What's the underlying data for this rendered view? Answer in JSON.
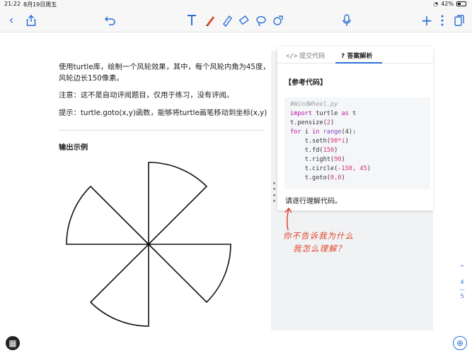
{
  "status": {
    "time": "21:22",
    "date": "8月19日周五",
    "battery": "42%"
  },
  "problem": {
    "line1": "使用turtle库，绘制一个风轮效果，其中，每个风轮内角为45度，",
    "line2": "风轮边长150像素。",
    "note": "注意：这不是自动评阅题目，仅用于练习，没有评阅。",
    "hint": "提示：turtle.goto(x,y)函数，能够将turtle画笔移动到坐标(x,y)",
    "output_title": "输出示例"
  },
  "panel": {
    "tab_submit": "提交代码",
    "tab_answer": "答案解析",
    "ref_title": "【参考代码】",
    "code": {
      "comment": "#WindWheel.py",
      "line2_kw": "import",
      "line2_mod": " turtle ",
      "line2_as": "as",
      "line2_alias": " t",
      "line3": "t.pensize(",
      "line3_num": "2",
      "line3_end": ")",
      "line4_for": "for",
      "line4_var": " i ",
      "line4_in": "in",
      "line4_fn": " range",
      "line4_args": "(4):",
      "line5": "    t.seth(",
      "line5_arg": "90*i",
      "line5_end": ")",
      "line6": "    t.fd(",
      "line6_arg": "150",
      "line6_end": ")",
      "line7": "    t.right(",
      "line7_arg": "90",
      "line7_end": ")",
      "line8": "    t.circle(",
      "line8_arg": "-150, 45",
      "line8_end": ")",
      "line9": "    t.goto(",
      "line9_arg": "0,0",
      "line9_end": ")"
    },
    "explain": "请逐行理解代码。"
  },
  "handwriting": {
    "line1": "你不告诉我为什么",
    "line2": "我怎么理解？"
  },
  "pager": {
    "current": "4",
    "total": "5"
  },
  "colors": {
    "accent": "#2b6fd6",
    "ink": "#e0442b"
  }
}
